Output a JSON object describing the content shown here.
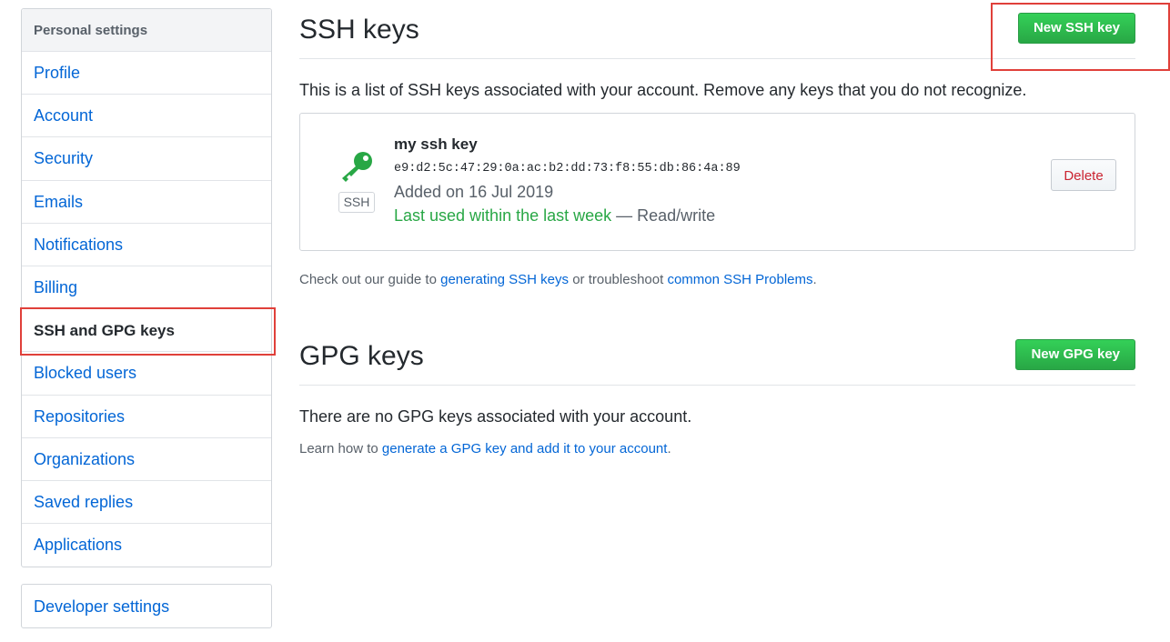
{
  "sidebar": {
    "header": "Personal settings",
    "items": [
      {
        "label": "Profile"
      },
      {
        "label": "Account"
      },
      {
        "label": "Security"
      },
      {
        "label": "Emails"
      },
      {
        "label": "Notifications"
      },
      {
        "label": "Billing"
      },
      {
        "label": "SSH and GPG keys",
        "selected": true
      },
      {
        "label": "Blocked users"
      },
      {
        "label": "Repositories"
      },
      {
        "label": "Organizations"
      },
      {
        "label": "Saved replies"
      },
      {
        "label": "Applications"
      }
    ],
    "developer_settings": "Developer settings"
  },
  "ssh": {
    "title": "SSH keys",
    "new_button": "New SSH key",
    "description": "This is a list of SSH keys associated with your account. Remove any keys that you do not recognize.",
    "key": {
      "name": "my ssh key",
      "fingerprint": "e9:d2:5c:47:29:0a:ac:b2:dd:73:f8:55:db:86:4a:89",
      "added": "Added on 16 Jul 2019",
      "last_used": "Last used within the last week",
      "access": " — Read/write",
      "badge": "SSH",
      "delete_label": "Delete"
    },
    "guide_prefix": "Check out our guide to ",
    "guide_link": "generating SSH keys",
    "guide_middle": " or troubleshoot ",
    "guide_link2": "common SSH Problems",
    "guide_suffix": "."
  },
  "gpg": {
    "title": "GPG keys",
    "new_button": "New GPG key",
    "empty": "There are no GPG keys associated with your account.",
    "learn_prefix": "Learn how to ",
    "learn_link": "generate a GPG key and add it to your account",
    "learn_suffix": "."
  },
  "colors": {
    "link": "#0366d6",
    "green": "#28a745",
    "danger": "#cb2431",
    "highlight": "#e0403a"
  }
}
